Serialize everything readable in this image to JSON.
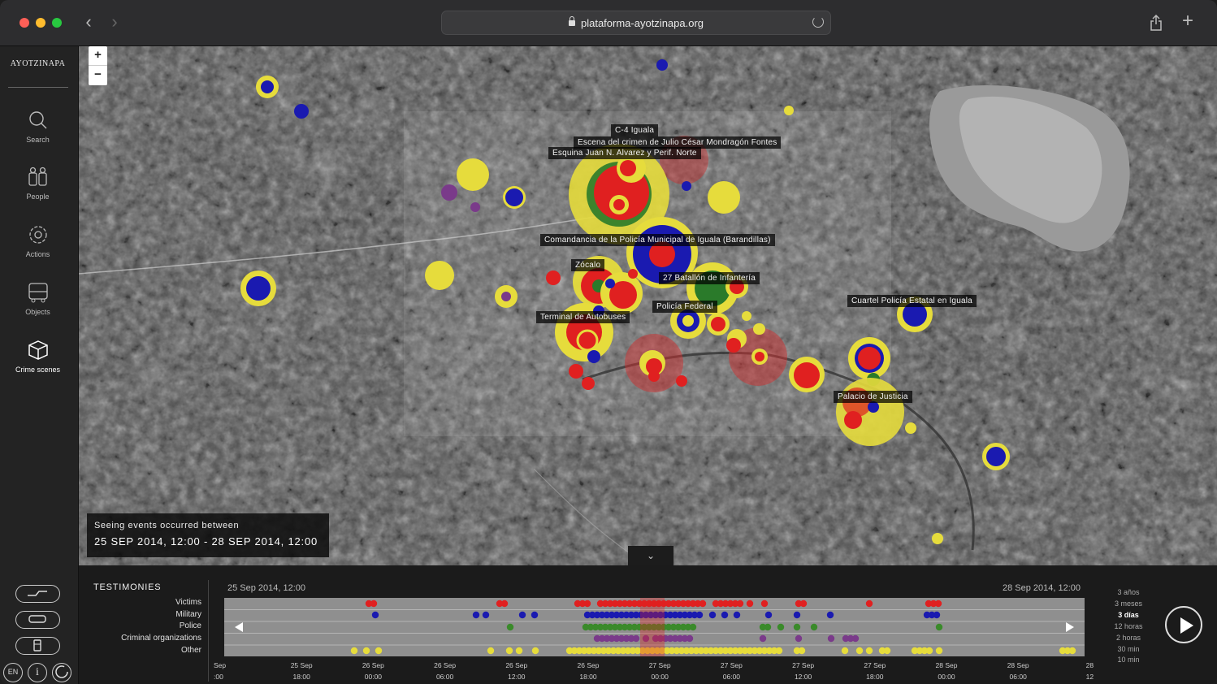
{
  "browser": {
    "url": "plataforma-ayotzinapa.org"
  },
  "sidebar": {
    "brand": "AYOTZINAPA",
    "items": [
      {
        "label": "Search",
        "icon": "search-icon"
      },
      {
        "label": "People",
        "icon": "people-icon"
      },
      {
        "label": "Actions",
        "icon": "actions-icon"
      },
      {
        "label": "Objects",
        "icon": "bus-icon"
      },
      {
        "label": "Crime scenes",
        "icon": "cube-icon"
      }
    ],
    "bottom": {
      "lang": "EN",
      "info": "i"
    }
  },
  "map": {
    "zoom_in": "+",
    "zoom_out": "−",
    "labels": [
      "C-4 Iguala",
      "Escena del crimen de Julio César Mondragón Fontes",
      "Esquina Juan N. Alvarez y Perif. Norte",
      "Comandancia de la Policía Municipal de Iguala (Barandillas)",
      "Zócalo",
      "27 Batallón de Infantería",
      "Policía Federal",
      "Terminal de Autobuses",
      "Cuartel Policía Estatal en Iguala",
      "Palacio de Justicia"
    ],
    "seeing_title": "Seeing events occurred between",
    "seeing_range": "25 SEP 2014, 12:00 - 28 SEP 2014, 12:00",
    "colors": {
      "victims": "#e02020",
      "military": "#1a1ab0",
      "police": "#3a8a2a",
      "criminal": "#7a3a8a",
      "other": "#e6dc3c"
    }
  },
  "timeline": {
    "title": "TESTIMONIES",
    "categories": [
      "Victims",
      "Military",
      "Police",
      "Criminal organizations",
      "Other"
    ],
    "start": "25 Sep 2014, 12:00",
    "end": "28 Sep 2014, 12:00",
    "ticks": [
      [
        "Sep",
        ":00"
      ],
      [
        "25 Sep",
        "18:00"
      ],
      [
        "26 Sep",
        "00:00"
      ],
      [
        "26 Sep",
        "06:00"
      ],
      [
        "26 Sep",
        "12:00"
      ],
      [
        "26 Sep",
        "18:00"
      ],
      [
        "27 Sep",
        "00:00"
      ],
      [
        "27 Sep",
        "06:00"
      ],
      [
        "27 Sep",
        "12:00"
      ],
      [
        "27 Sep",
        "18:00"
      ],
      [
        "28 Sep",
        "00:00"
      ],
      [
        "28 Sep",
        "06:00"
      ],
      [
        "28",
        "12"
      ]
    ],
    "zoom_levels": [
      "3 años",
      "3 meses",
      "3 días",
      "12 horas",
      "2 horas",
      "30 min",
      "10 min"
    ],
    "zoom_selected": "3 días"
  }
}
